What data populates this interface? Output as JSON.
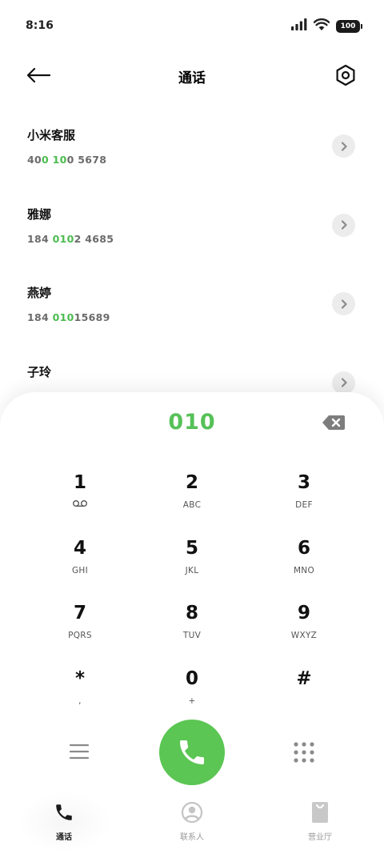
{
  "status_bar": {
    "time": "8:16",
    "battery": "100"
  },
  "header": {
    "title": "通话"
  },
  "contacts": [
    {
      "name": "小米客服",
      "number_parts": [
        {
          "t": "40",
          "hl": false
        },
        {
          "t": "0",
          "hl": true
        },
        {
          "t": " ",
          "hl": false
        },
        {
          "t": "10",
          "hl": true
        },
        {
          "t": "0 5678",
          "hl": false
        }
      ]
    },
    {
      "name": "雅娜",
      "number_parts": [
        {
          "t": "184 ",
          "hl": false
        },
        {
          "t": "010",
          "hl": true
        },
        {
          "t": "2 4685",
          "hl": false
        }
      ]
    },
    {
      "name": "燕婷",
      "number_parts": [
        {
          "t": "184 ",
          "hl": false
        },
        {
          "t": "010",
          "hl": true
        },
        {
          "t": "15689",
          "hl": false
        }
      ]
    },
    {
      "name": "子玲",
      "number_parts": []
    }
  ],
  "dialer": {
    "input_value": "010",
    "keys": [
      {
        "digit": "1",
        "letters": "",
        "sub_icon": "voicemail-icon"
      },
      {
        "digit": "2",
        "letters": "ABC"
      },
      {
        "digit": "3",
        "letters": "DEF"
      },
      {
        "digit": "4",
        "letters": "GHI"
      },
      {
        "digit": "5",
        "letters": "JKL"
      },
      {
        "digit": "6",
        "letters": "MNO"
      },
      {
        "digit": "7",
        "letters": "PQRS"
      },
      {
        "digit": "8",
        "letters": "TUV"
      },
      {
        "digit": "9",
        "letters": "WXYZ"
      },
      {
        "digit": "*",
        "letters": ","
      },
      {
        "digit": "0",
        "letters": "+"
      },
      {
        "digit": "#",
        "letters": ""
      }
    ]
  },
  "tabs": [
    {
      "label": "通话",
      "icon": "phone-icon",
      "active": true
    },
    {
      "label": "联系人",
      "icon": "contacts-icon",
      "active": false
    },
    {
      "label": "营业厅",
      "icon": "store-bag-icon",
      "active": false
    }
  ],
  "colors": {
    "accent_green": "#5bc653",
    "highlight_green": "#4cbb4f"
  }
}
